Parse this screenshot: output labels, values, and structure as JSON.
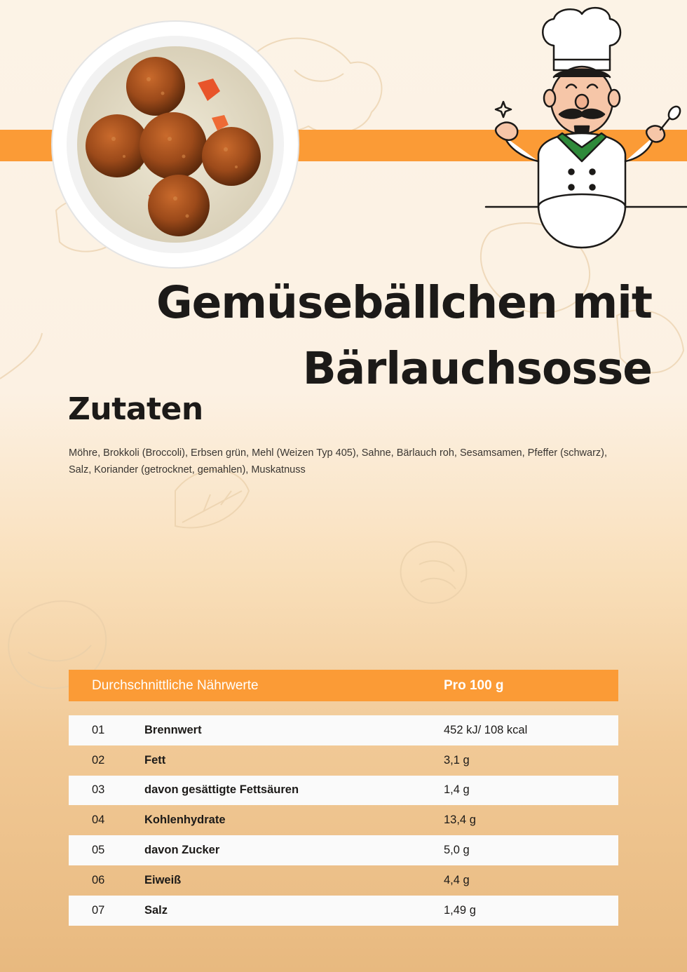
{
  "header": {
    "photo_icon": "bowl-with-vegetable-balls-image",
    "chef_icon": "chef-illustration"
  },
  "recipe": {
    "title_line1": "Gemüsebällchen mit",
    "title_line2": "Bärlauchsosse"
  },
  "ingredients": {
    "heading": "Zutaten",
    "text": "Möhre, Brokkoli (Broccoli), Erbsen grün, Mehl (Weizen Typ 405), Sahne, Bärlauch roh, Sesamsamen, Pfeffer (schwarz), Salz, Koriander (getrocknet, gemahlen), Muskatnuss"
  },
  "nutrition": {
    "header_label": "Durchschnittliche Nährwerte",
    "header_value": "Pro 100 g",
    "rows": [
      {
        "num": "01",
        "name": "Brennwert",
        "value": "452 kJ/ 108 kcal"
      },
      {
        "num": "02",
        "name": "Fett",
        "value": "3,1 g"
      },
      {
        "num": "03",
        "name": "davon gesättigte Fettsäuren",
        "value": "1,4 g"
      },
      {
        "num": "04",
        "name": "Kohlenhydrate",
        "value": "13,4 g"
      },
      {
        "num": "05",
        "name": "davon Zucker",
        "value": "5,0 g"
      },
      {
        "num": "06",
        "name": "Eiweiß",
        "value": "4,4 g"
      },
      {
        "num": "07",
        "name": "Salz",
        "value": "1,49 g"
      }
    ]
  },
  "colors": {
    "accent": "#fb9b36",
    "text": "#1c1a18",
    "row_light": "#fafafa"
  }
}
